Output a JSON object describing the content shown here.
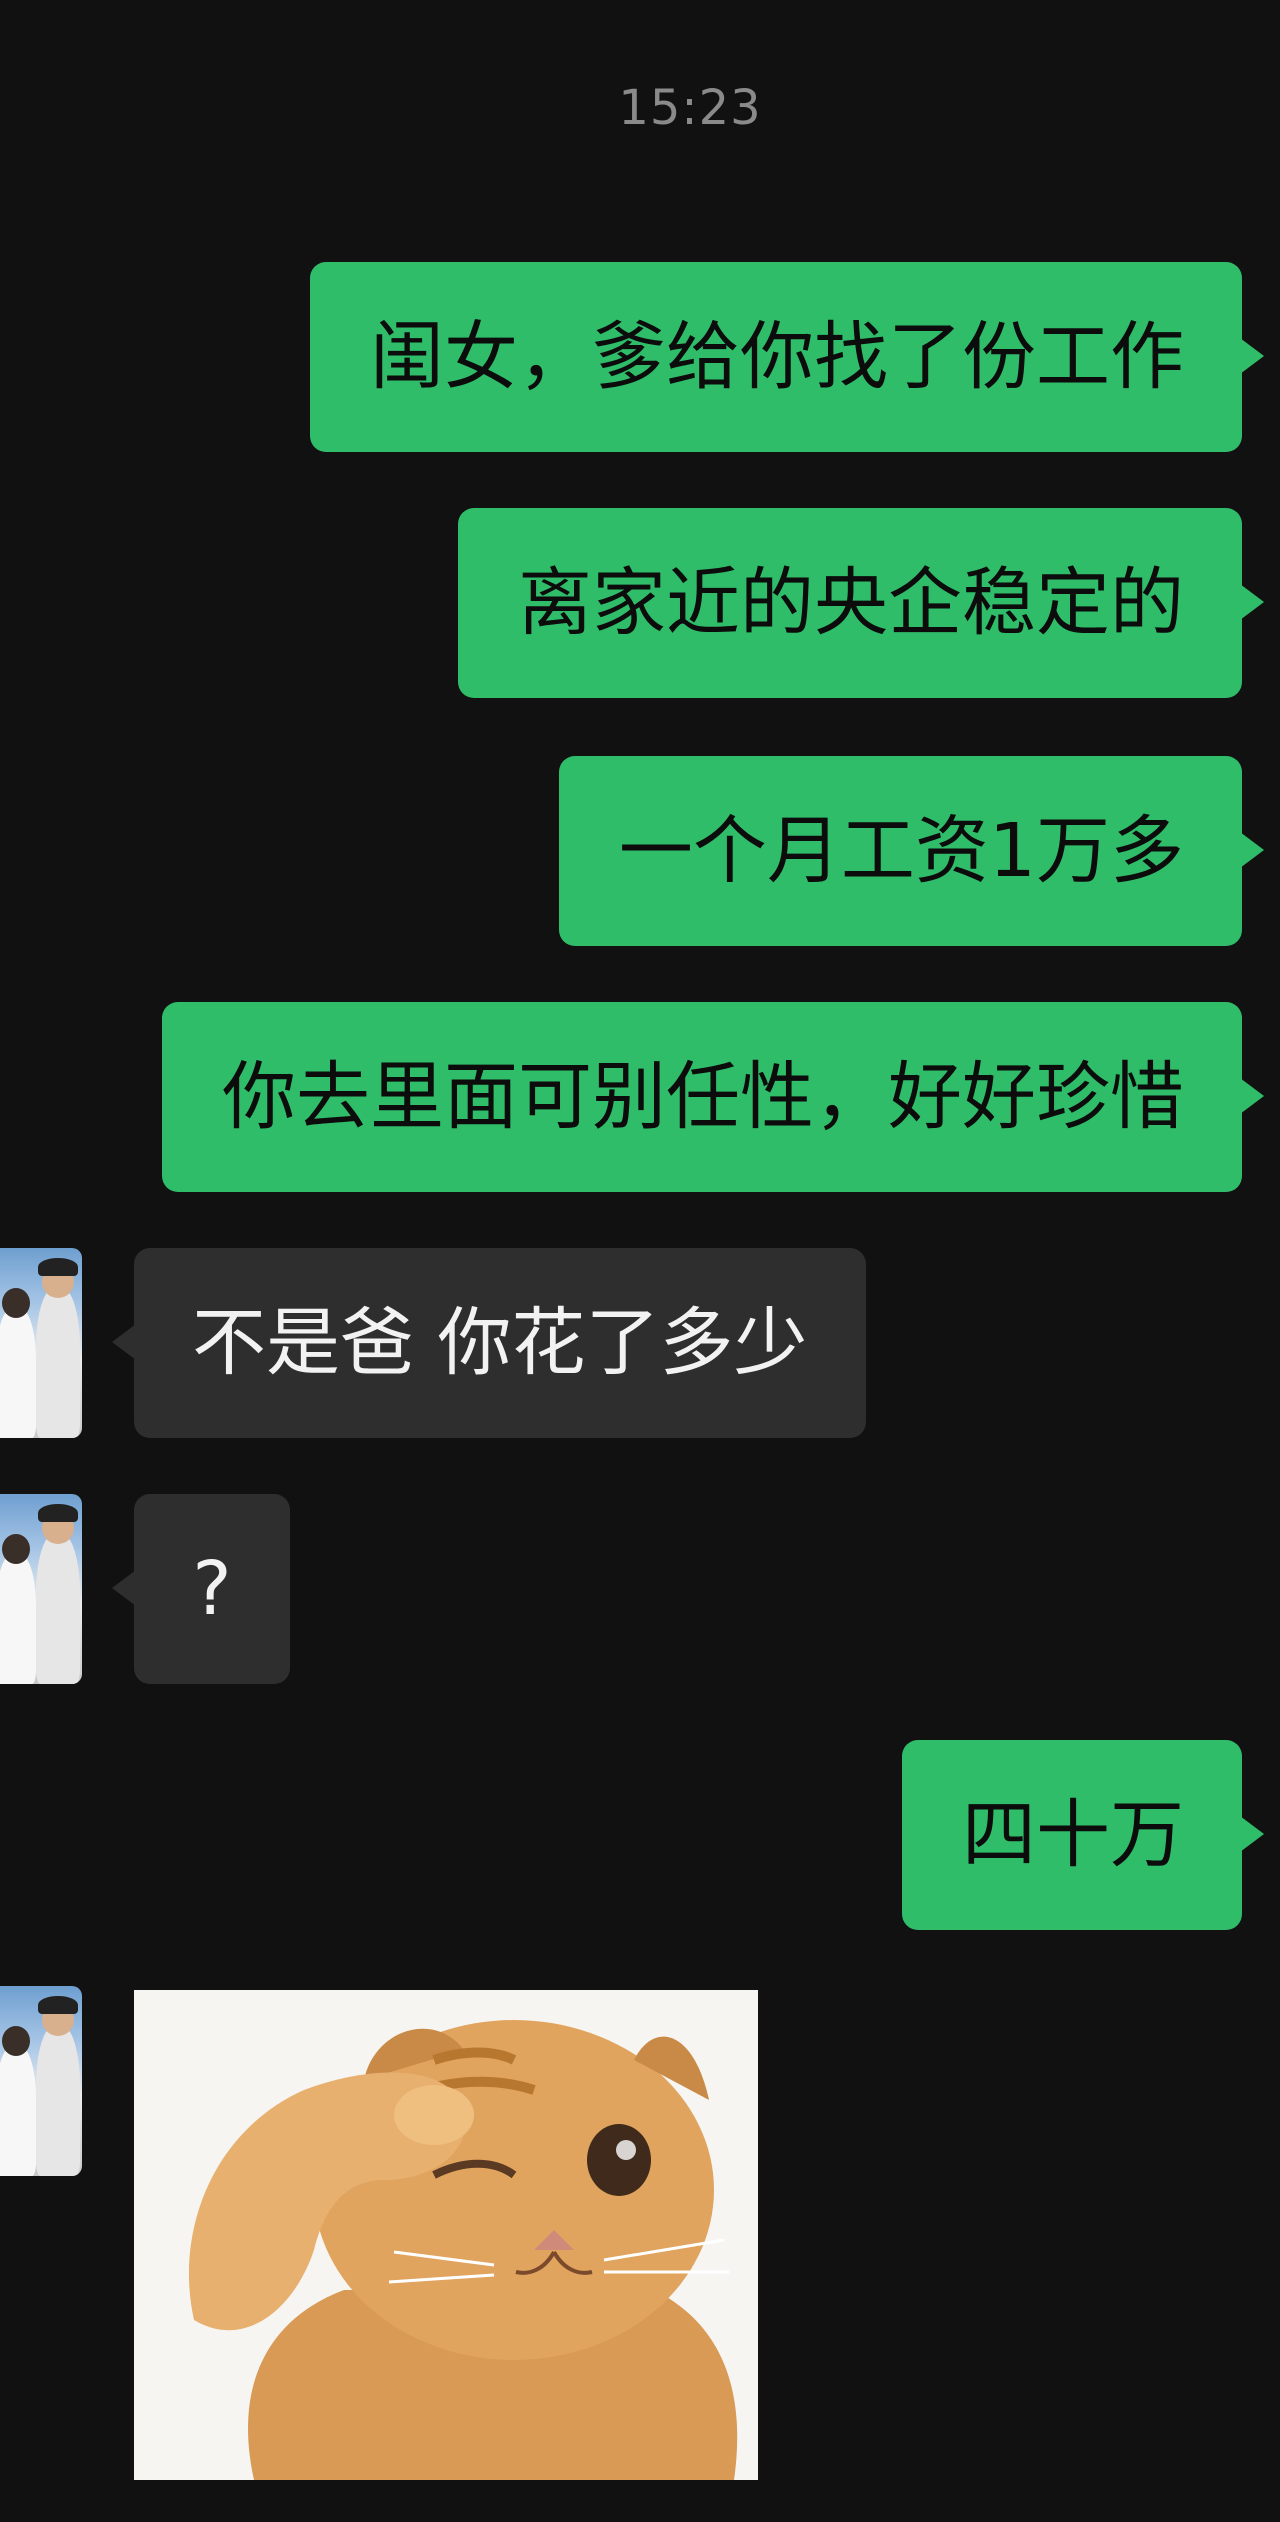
{
  "chat": {
    "timestamp": "15:23",
    "messages": [
      {
        "side": "out",
        "text": "闺女，爹给你找了份工作"
      },
      {
        "side": "out",
        "text": "离家近的央企稳定的"
      },
      {
        "side": "out",
        "text": "一个月工资1万多"
      },
      {
        "side": "out",
        "text": "你去里面可别任性，好好珍惜"
      },
      {
        "side": "in",
        "text": "不是爸 你花了多少"
      },
      {
        "side": "in",
        "text": "?"
      },
      {
        "side": "out",
        "text": "四十万"
      },
      {
        "side": "in",
        "type": "sticker",
        "sticker": "cat-facepalm-wink"
      }
    ]
  },
  "colors": {
    "background": "#111111",
    "outgoing_bubble": "#2fbd6a",
    "incoming_bubble": "#2e2e2e",
    "timestamp_text": "#8a8a8a"
  },
  "icons": {
    "avatar": "contact-avatar-photo",
    "sticker": "cat-facepalm-sticker"
  }
}
